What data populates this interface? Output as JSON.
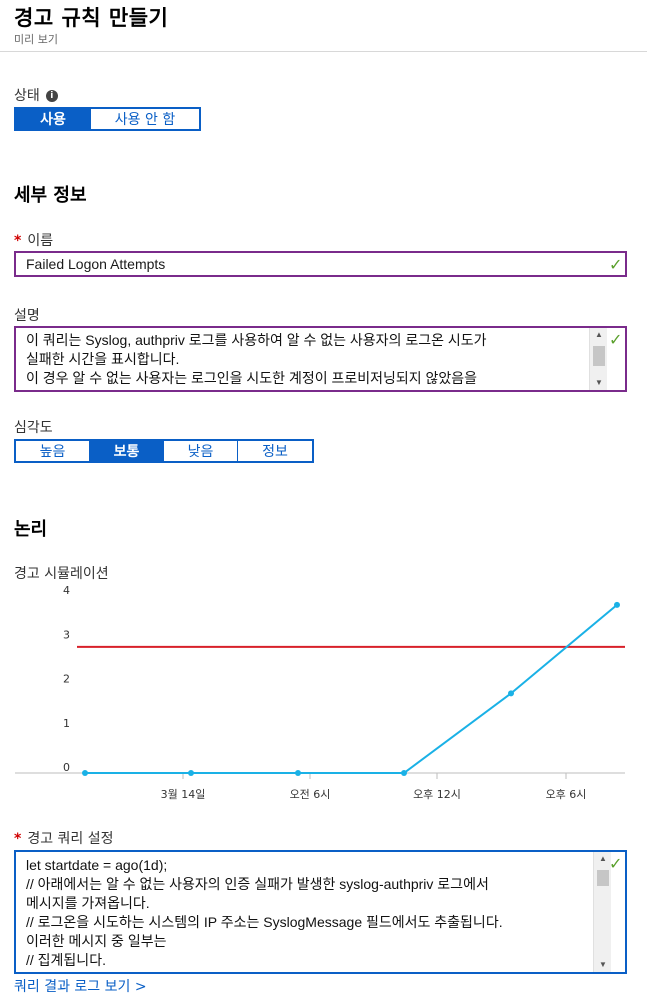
{
  "header": {
    "title": "경고 규칙 만들기",
    "subtitle": "미리 보기"
  },
  "status": {
    "label": "상태",
    "info_icon": "i",
    "options": [
      "사용",
      "사용 안 함"
    ],
    "selected": "사용"
  },
  "details": {
    "heading": "세부 정보",
    "name_label": "이름",
    "required_mark": "*",
    "name_value": "Failed Logon Attempts",
    "description_label": "설명",
    "description_lines": [
      " 이 쿼리는 Syslog, authpriv 로그를 사용하여 알 수 없는 사용자의 로그온 시도가",
      "실패한 시간을 표시합니다.",
      "이 경우 알 수 없는 사용자는 로그인을 시도한 계정이 프로비저닝되지 않았음을"
    ],
    "valid_check": "✓"
  },
  "severity": {
    "label": "심각도",
    "options": [
      "높음",
      "보통",
      "낮음",
      "정보"
    ],
    "selected": "보통"
  },
  "logic": {
    "heading": "논리",
    "simulation_label": "경고 시뮬레이션"
  },
  "chart_data": {
    "type": "line",
    "y_ticks": [
      "4",
      "3",
      "2",
      "1",
      "0"
    ],
    "ylim": [
      0,
      4
    ],
    "x_tick_labels": [
      "3월 14일",
      "오전 6시",
      "오후 12시",
      "오후 6시"
    ],
    "series": [
      {
        "values": [
          0,
          0,
          0,
          0,
          1.8,
          3.8
        ]
      }
    ],
    "threshold": 2.85,
    "colors": {
      "series": "#1ab1e6",
      "threshold": "#d8202a",
      "axis": "#bdbdbd"
    }
  },
  "query": {
    "label": "경고 쿼리 설정",
    "required_mark": "*",
    "lines": [
      "let startdate = ago(1d);",
      "// 아래에서는 알 수 없는 사용자의 인증 실패가 발생한 syslog-authpriv 로그에서",
      "메시지를 가져옵니다.",
      "// 로그온을 시도하는 시스템의 IP 주소는 SyslogMessage 필드에서도 추출됩니다.",
      "이러한 메시지 중 일부는",
      "// 집계됩니다."
    ],
    "view_link": "쿼리 결과 로그 보기 >"
  },
  "colors": {
    "accent": "#0a5fc6",
    "input_border": "#7a2b8b",
    "valid": "#5aa02c"
  }
}
